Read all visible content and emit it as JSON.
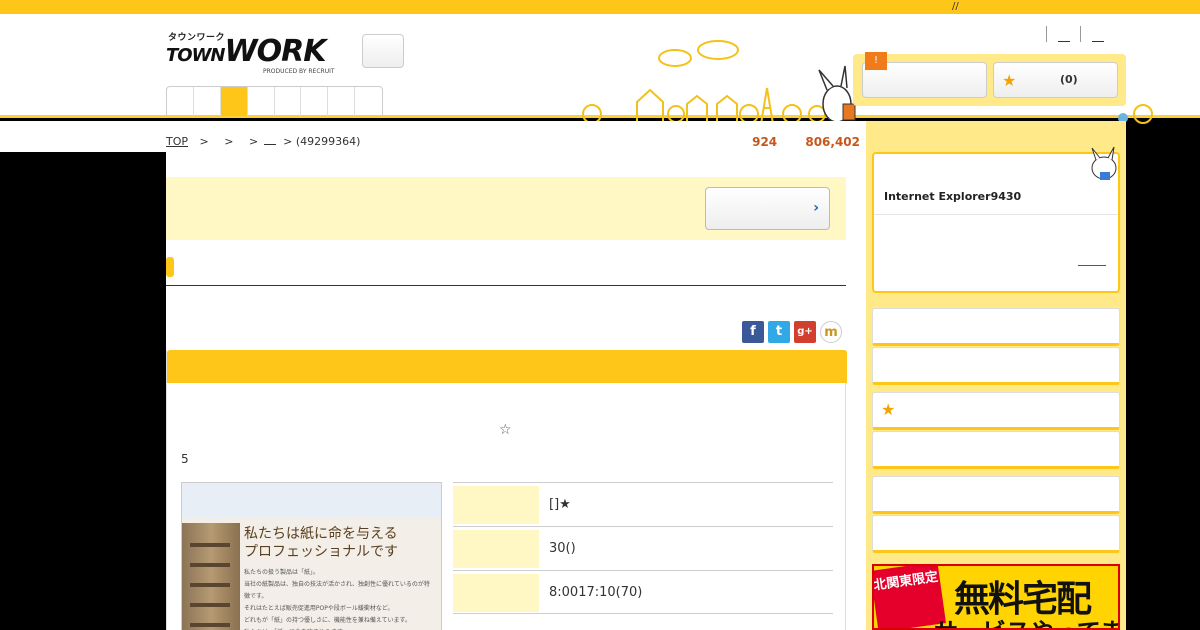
{
  "topbar": {
    "mark": "//"
  },
  "header": {
    "logo_kana": "タウンワーク",
    "logo_word": "TOWN",
    "logo_word2": "WORK",
    "logo_produced": "PRODUCED BY RECRUIT",
    "warning_badge": "!",
    "favorites_count": "(0)"
  },
  "breadcrumb": {
    "top_label": "TOP",
    "sep1": ">",
    "sep2": ">",
    "sep3": ">",
    "sep4": "> (49299364)"
  },
  "stats": {
    "count1": "924",
    "count2": "806,402"
  },
  "social": {
    "facebook": "f",
    "twitter": "t",
    "googleplus": "g+",
    "mixi": "m"
  },
  "job": {
    "star_symbol": "☆",
    "number": "5",
    "image_headline_1": "私たちは紙に命を与える",
    "image_headline_2": "プロフェッショナルです",
    "image_body": "私たちの扱う製品は「紙」。\n当社の紙製品は、独自の技法が活かされ、独創性に優れているのが特徴です。\nそれはたとえば販売促進用POPや段ボール緩衝材など。\nどれもが「紙」の持つ優しさに、機能性を兼ね備えています。\n私たちは、「紙」に命を吹き込みます。",
    "rows": [
      {
        "value": "[]★"
      },
      {
        "value": "30()"
      },
      {
        "value": "8:0017:10(70)"
      }
    ]
  },
  "sidebar": {
    "widget_title": "Internet Explorer9430",
    "ad_tag": "北関東限定",
    "ad_main": "無料宅配",
    "ad_sub": "サービスやってます!"
  },
  "colors": {
    "accent": "#ffc61a",
    "panel": "#ffe988",
    "banner": "#fff8c4",
    "stats": "#c8561a",
    "link": "#1a63b8"
  }
}
